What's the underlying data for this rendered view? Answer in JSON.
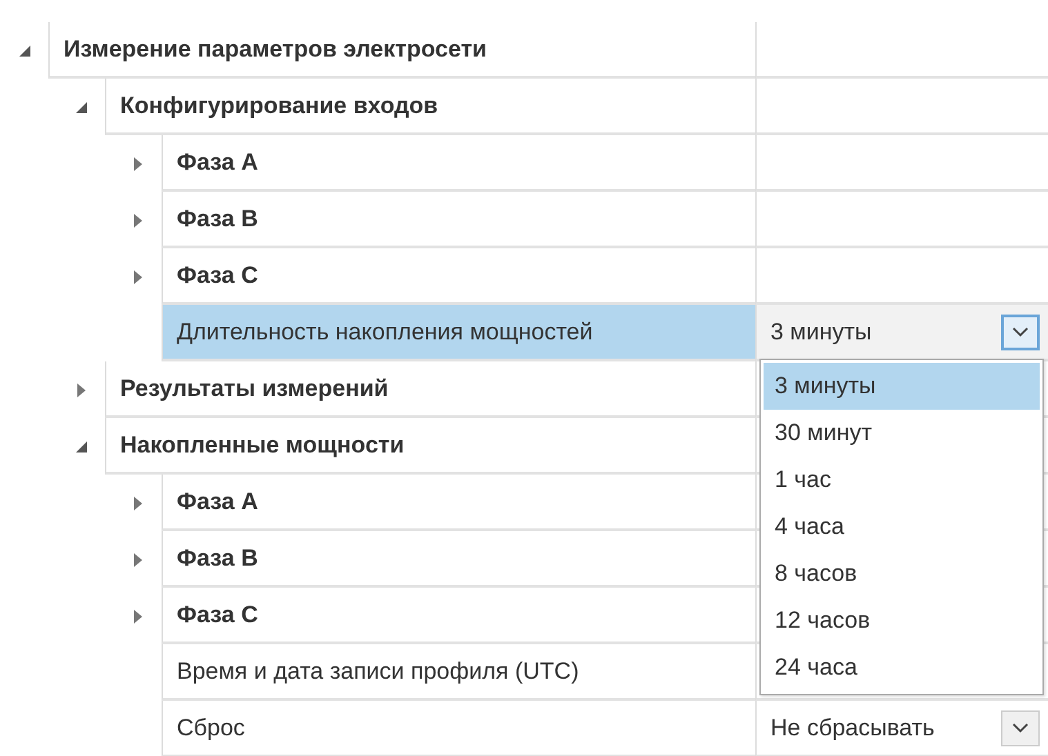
{
  "tree": [
    {
      "kind": "group",
      "label": "Измерение параметров электросети",
      "expanded": true,
      "selected": false,
      "children": [
        {
          "kind": "group",
          "label": "Конфигурирование входов",
          "expanded": true,
          "selected": false,
          "children": [
            {
              "kind": "group",
              "label": "Фаза A",
              "expanded": false,
              "selected": false
            },
            {
              "kind": "group",
              "label": "Фаза B",
              "expanded": false,
              "selected": false
            },
            {
              "kind": "group",
              "label": "Фаза C",
              "expanded": false,
              "selected": false
            },
            {
              "kind": "property",
              "label": "Длительность накопления мощностей",
              "selected": true,
              "value": "3 минуты",
              "open": true,
              "options": [
                {
                  "label": "3 минуты",
                  "selected": true
                },
                {
                  "label": "30 минут",
                  "selected": false
                },
                {
                  "label": "1 час",
                  "selected": false
                },
                {
                  "label": "4 часа",
                  "selected": false
                },
                {
                  "label": "8 часов",
                  "selected": false
                },
                {
                  "label": "12 часов",
                  "selected": false
                },
                {
                  "label": "24 часа",
                  "selected": false
                }
              ]
            }
          ]
        },
        {
          "kind": "group",
          "label": "Результаты измерений",
          "expanded": false,
          "selected": false
        },
        {
          "kind": "group",
          "label": "Накопленные мощности",
          "expanded": true,
          "selected": false,
          "children": [
            {
              "kind": "group",
              "label": "Фаза A",
              "expanded": false,
              "selected": false
            },
            {
              "kind": "group",
              "label": "Фаза B",
              "expanded": false,
              "selected": false
            },
            {
              "kind": "group",
              "label": "Фаза C",
              "expanded": false,
              "selected": false
            },
            {
              "kind": "property",
              "label": "Время и дата записи профиля (UTC)",
              "selected": false
            },
            {
              "kind": "property",
              "label": "Сброс",
              "selected": false,
              "value": "Не сбрасывать",
              "open": false
            }
          ]
        }
      ]
    }
  ]
}
